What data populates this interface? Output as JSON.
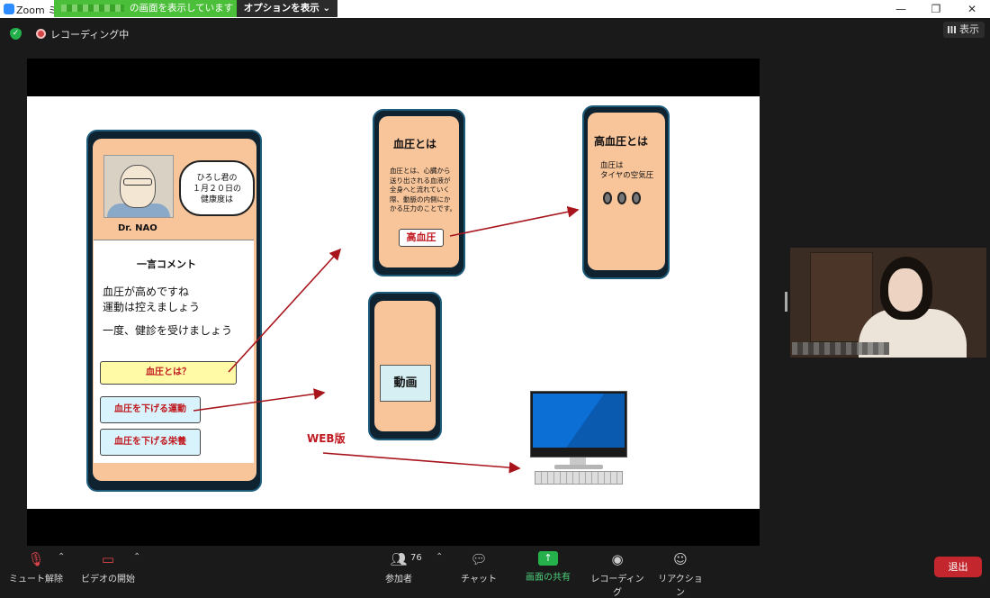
{
  "titlebar": {
    "app_title": "Zoom ミ",
    "share_banner": "の画面を表示しています",
    "options_label": "オプションを表示 ⌄",
    "minimize": "—",
    "restore": "❐",
    "close": "✕"
  },
  "status": {
    "recording_label": "レコーディング中",
    "view_label": "表示"
  },
  "slide": {
    "main_phone": {
      "bubble_text": "ひろし君の\n１月２０日の\n健康度は",
      "doctor_name": "Dr. NAO",
      "comment_title": "一言コメント",
      "comment_line1": "血圧が高めですね\n運動は控えましょう",
      "comment_line2": "一度、健診を受けましょう",
      "btn_bp": "血圧とは？",
      "btn_exercise": "血圧を下げる運動",
      "btn_nutrition": "血圧を下げる栄養"
    },
    "bp_phone": {
      "title": "血圧とは",
      "text": "血圧とは、心臓から\n送り出される血液が\n全身へと流れていく\n際、動脈の内側にか\nかる圧力のことです。",
      "button": "高血圧"
    },
    "hbp_phone": {
      "title": "高血圧とは",
      "text": "血圧は\nタイヤの空気圧"
    },
    "video_phone": {
      "label": "動画"
    },
    "web_label": "WEB版"
  },
  "toolbar": {
    "mute_label": "ミュート解除",
    "video_label": "ビデオの開始",
    "participants_count": "76",
    "participants_label": "参加者",
    "chat_label": "チャット",
    "share_label": "画面の共有",
    "record_label": "レコーディング",
    "reaction_label": "リアクション",
    "leave_label": "退出"
  },
  "colors": {
    "accent_red": "#c0181f",
    "share_green": "#25b04c",
    "leave_red": "#c4262e"
  },
  "icons": [
    "zoom-logo-icon",
    "shield-icon",
    "record-icon",
    "grid-icon",
    "mic-muted-icon",
    "video-off-icon",
    "participants-icon",
    "chat-icon",
    "share-screen-icon",
    "record-button-icon",
    "reaction-icon"
  ]
}
